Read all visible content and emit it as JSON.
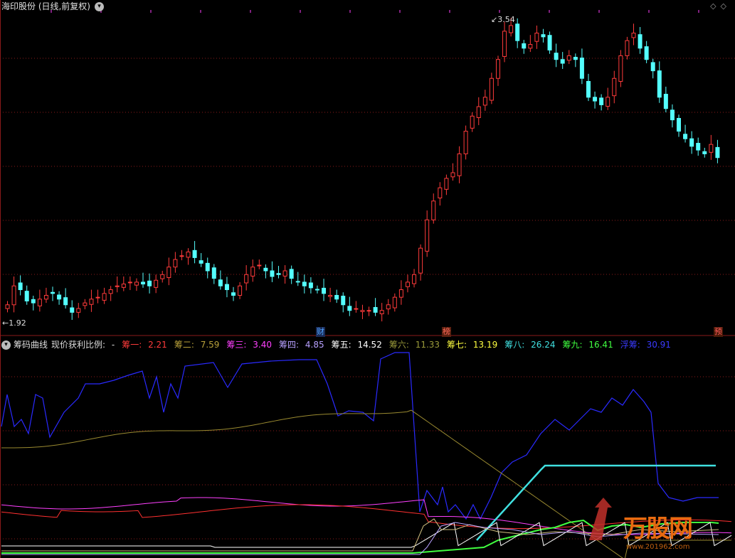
{
  "header": {
    "stock_title": "海印股份 (日线,前复权)"
  },
  "price_labels": {
    "high": "3.54",
    "low": "1.92"
  },
  "event_markers": [
    {
      "text": "财",
      "color": "#4fa3ff",
      "bg": "#1a2a55"
    },
    {
      "text": "榜",
      "color": "#ff6a5a",
      "bg": "#5a2010"
    },
    {
      "text": "预",
      "color": "#ff5a5a",
      "bg": "#4a1a08"
    }
  ],
  "indicator": {
    "name": "筹码曲线",
    "ratio_label": "现价获利比例:",
    "ratio_value": "-",
    "items": [
      {
        "label": "筹一:",
        "value": "2.21",
        "color": "#ff3b3b"
      },
      {
        "label": "筹二:",
        "value": "7.59",
        "color": "#b8a03a"
      },
      {
        "label": "筹三:",
        "value": "3.40",
        "color": "#ff40ff"
      },
      {
        "label": "筹四:",
        "value": "4.85",
        "color": "#b7a0ff"
      },
      {
        "label": "筹五:",
        "value": "14.52",
        "color": "#ffffff"
      },
      {
        "label": "筹六:",
        "value": "11.33",
        "color": "#9a9a3a"
      },
      {
        "label": "筹七:",
        "value": "13.19",
        "color": "#ffff40"
      },
      {
        "label": "筹八:",
        "value": "26.24",
        "color": "#40e0e0"
      },
      {
        "label": "筹九:",
        "value": "16.41",
        "color": "#40ff40"
      },
      {
        "label": "浮筹:",
        "value": "30.91",
        "color": "#3a3aff"
      }
    ]
  },
  "watermark": {
    "text": "万股网",
    "sub": "www.201962.com"
  },
  "colors": {
    "up": "#ff3b3b",
    "down": "#54ffff",
    "grid": "#8a1a1a"
  }
}
